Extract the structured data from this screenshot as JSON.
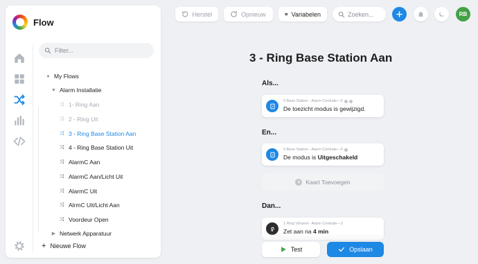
{
  "app": {
    "name": "Flow"
  },
  "colors": {
    "accent": "#1e88e5",
    "success": "#43a047",
    "muted": "#a6abb3"
  },
  "sidebar": {
    "filter_placeholder": "Filter...",
    "rail": [
      "home-icon",
      "dashboard-grid-icon",
      "flows-shuffle-icon",
      "insights-chart-icon",
      "code-icon",
      "settings-gear-icon"
    ],
    "tree": [
      {
        "label": "My Flows",
        "type": "folder",
        "expanded": true
      },
      {
        "label": "Alarm Installatie",
        "type": "folder",
        "expanded": true
      },
      {
        "label": "1- Ring Aan",
        "type": "flow",
        "disabled": true
      },
      {
        "label": "2 - Ring Uit",
        "type": "flow",
        "disabled": true
      },
      {
        "label": "3 - Ring Base Station Aan",
        "type": "flow",
        "active": true
      },
      {
        "label": "4 - Ring Base Station Uit",
        "type": "flow"
      },
      {
        "label": "AlarmC Aan",
        "type": "flow"
      },
      {
        "label": "AlarmC Aan/Licht Uit",
        "type": "flow"
      },
      {
        "label": "AlarmC Uit",
        "type": "flow"
      },
      {
        "label": "AlrmC Uit/Licht Aan",
        "type": "flow"
      },
      {
        "label": "Voordeur Open",
        "type": "flow"
      },
      {
        "label": "Netwerk Apparatuur",
        "type": "folder",
        "expanded": false
      }
    ],
    "new_flow": "Nieuwe Flow"
  },
  "toolbar": {
    "undo": "Herstel",
    "redo": "Opnieuw",
    "variables": "Variabelen",
    "search_placeholder": "Zoeken...",
    "user_initials": "RB"
  },
  "editor": {
    "title": "3 - Ring Base Station Aan",
    "when_label": "Als...",
    "and_label": "En...",
    "then_label": "Dan...",
    "trigger": {
      "meta": "0 Base Station - Alarm Centrale—3",
      "text": "De toezicht modus is gewijzigd."
    },
    "condition": {
      "meta": "0 Base Station - Alarm Centrale—3",
      "text_prefix": "De modus is ",
      "text_value": "Uitgeschakeld"
    },
    "add_card": "Kaart Toevoegen",
    "action": {
      "meta": "1 Ring Virtueel - Alarm Centrale—3",
      "text_prefix": "Zet aan na ",
      "text_value": "4 min"
    },
    "test": "Test",
    "save": "Opslaan"
  }
}
